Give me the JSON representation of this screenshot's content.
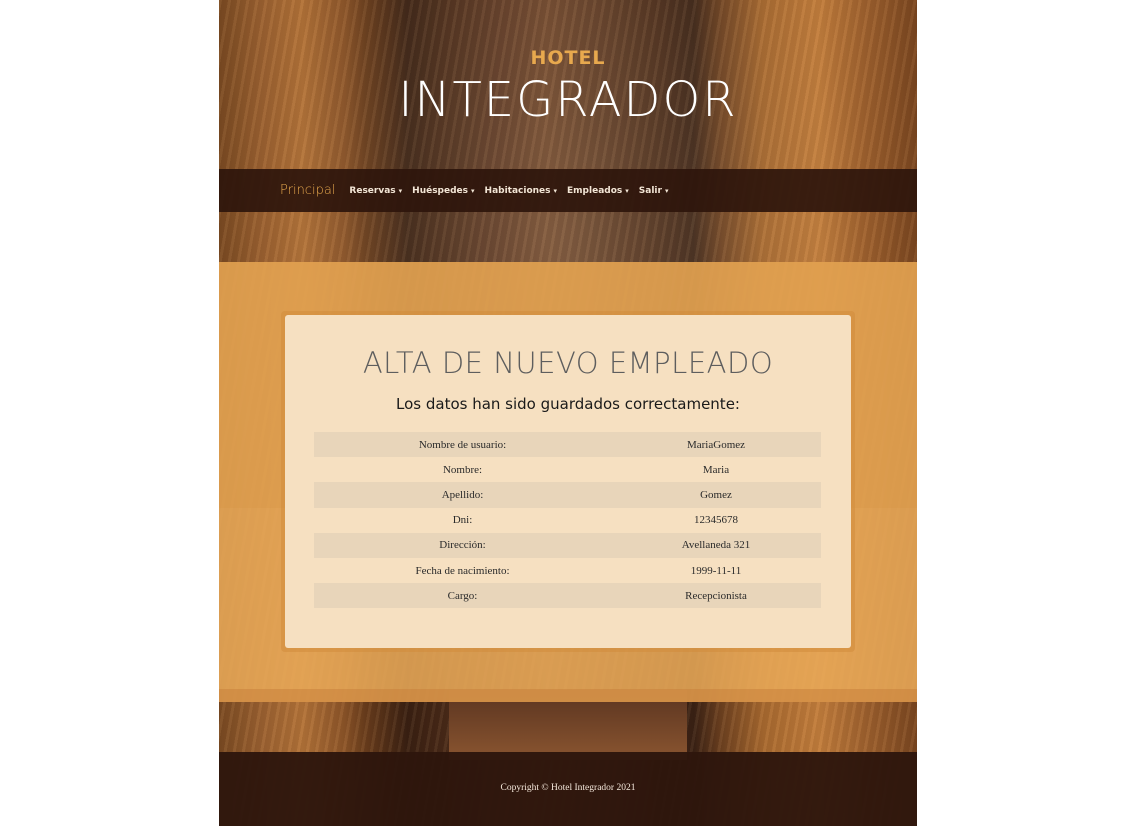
{
  "brand": {
    "top": "HOTEL",
    "main": "INTEGRADOR"
  },
  "nav": {
    "brand": "Principal",
    "items": [
      "Reservas",
      "Huéspedes",
      "Habitaciones",
      "Empleados",
      "Salir"
    ],
    "caret": "▾"
  },
  "card": {
    "title": "ALTA DE NUEVO EMPLEADO",
    "subtitle": "Los datos han sido guardados correctamente:",
    "rows": [
      {
        "label": "Nombre de usuario:",
        "value": "MariaGomez"
      },
      {
        "label": "Nombre:",
        "value": "Maria"
      },
      {
        "label": "Apellido:",
        "value": "Gomez"
      },
      {
        "label": "Dni:",
        "value": "12345678"
      },
      {
        "label": "Dirección:",
        "value": "Avellaneda 321"
      },
      {
        "label": "Fecha de nacimiento:",
        "value": "1999-11-11"
      },
      {
        "label": "Cargo:",
        "value": "Recepcionista"
      }
    ]
  },
  "footer": {
    "copyright": "Copyright © Hotel Integrador 2021"
  },
  "colors": {
    "accent": "#e8a94e",
    "navbar": "#2e160c",
    "card": "#f6e0c1",
    "band": "#e8a958"
  }
}
